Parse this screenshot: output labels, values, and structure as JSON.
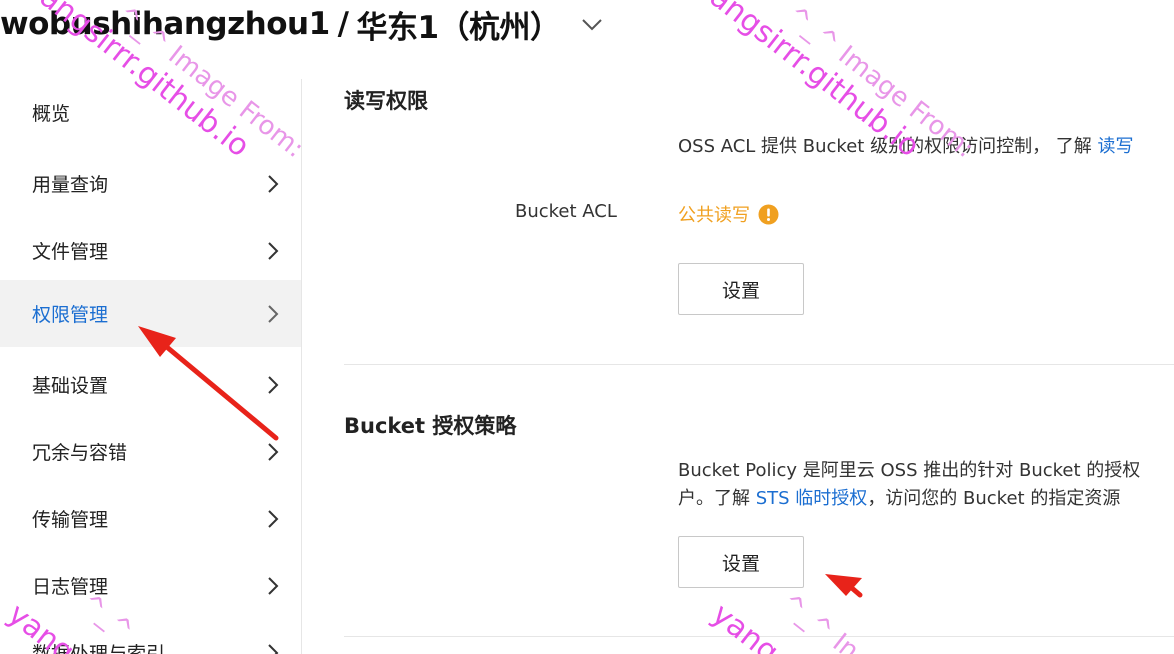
{
  "header": {
    "bucket_name": "wobushihangzhou1",
    "separator": "/",
    "region": "华东1（杭州）",
    "region_toggle_icon": "chevron-down-icon"
  },
  "sidebar": {
    "items": [
      {
        "label": "概览",
        "has_chevron": false,
        "active": false
      },
      {
        "label": "用量查询",
        "has_chevron": true,
        "active": false
      },
      {
        "label": "文件管理",
        "has_chevron": true,
        "active": false
      },
      {
        "label": "权限管理",
        "has_chevron": true,
        "active": true
      },
      {
        "label": "基础设置",
        "has_chevron": true,
        "active": false
      },
      {
        "label": "冗余与容错",
        "has_chevron": true,
        "active": false
      },
      {
        "label": "传输管理",
        "has_chevron": true,
        "active": false
      },
      {
        "label": "日志管理",
        "has_chevron": true,
        "active": false
      },
      {
        "label": "数据处理与索引",
        "has_chevron": true,
        "active": false
      }
    ]
  },
  "main": {
    "acl_section": {
      "title": "读写权限",
      "desc_prefix": "OSS ACL 提供 Bucket 级别的权限访问控制，  了解 ",
      "desc_link": "读写",
      "field_label": "Bucket ACL",
      "field_value": "公共读写",
      "field_icon": "exclamation-circle-icon",
      "button_label": "设置"
    },
    "policy_section": {
      "title": "Bucket 授权策略",
      "desc_line1": "Bucket Policy 是阿里云 OSS 推出的针对 Bucket 的授权",
      "desc_line2_prefix": "户。了解 ",
      "desc_line2_link": "STS 临时授权",
      "desc_line2_suffix": "，访问您的 Bucket 的指定资源",
      "button_label": "设置"
    }
  },
  "watermark": {
    "line1": "^_^ Image From:",
    "line2": "yangsirrr.github.io",
    "partial_1": "yang",
    "partial_2": "^_^ In",
    "partial_3": "^_^",
    "color": "#e64ee6"
  },
  "colors": {
    "accent_link": "#1b6ed1",
    "warning": "#f0a020",
    "annotation_arrow": "#e8231a",
    "active_nav_bg": "#f2f2f2"
  }
}
